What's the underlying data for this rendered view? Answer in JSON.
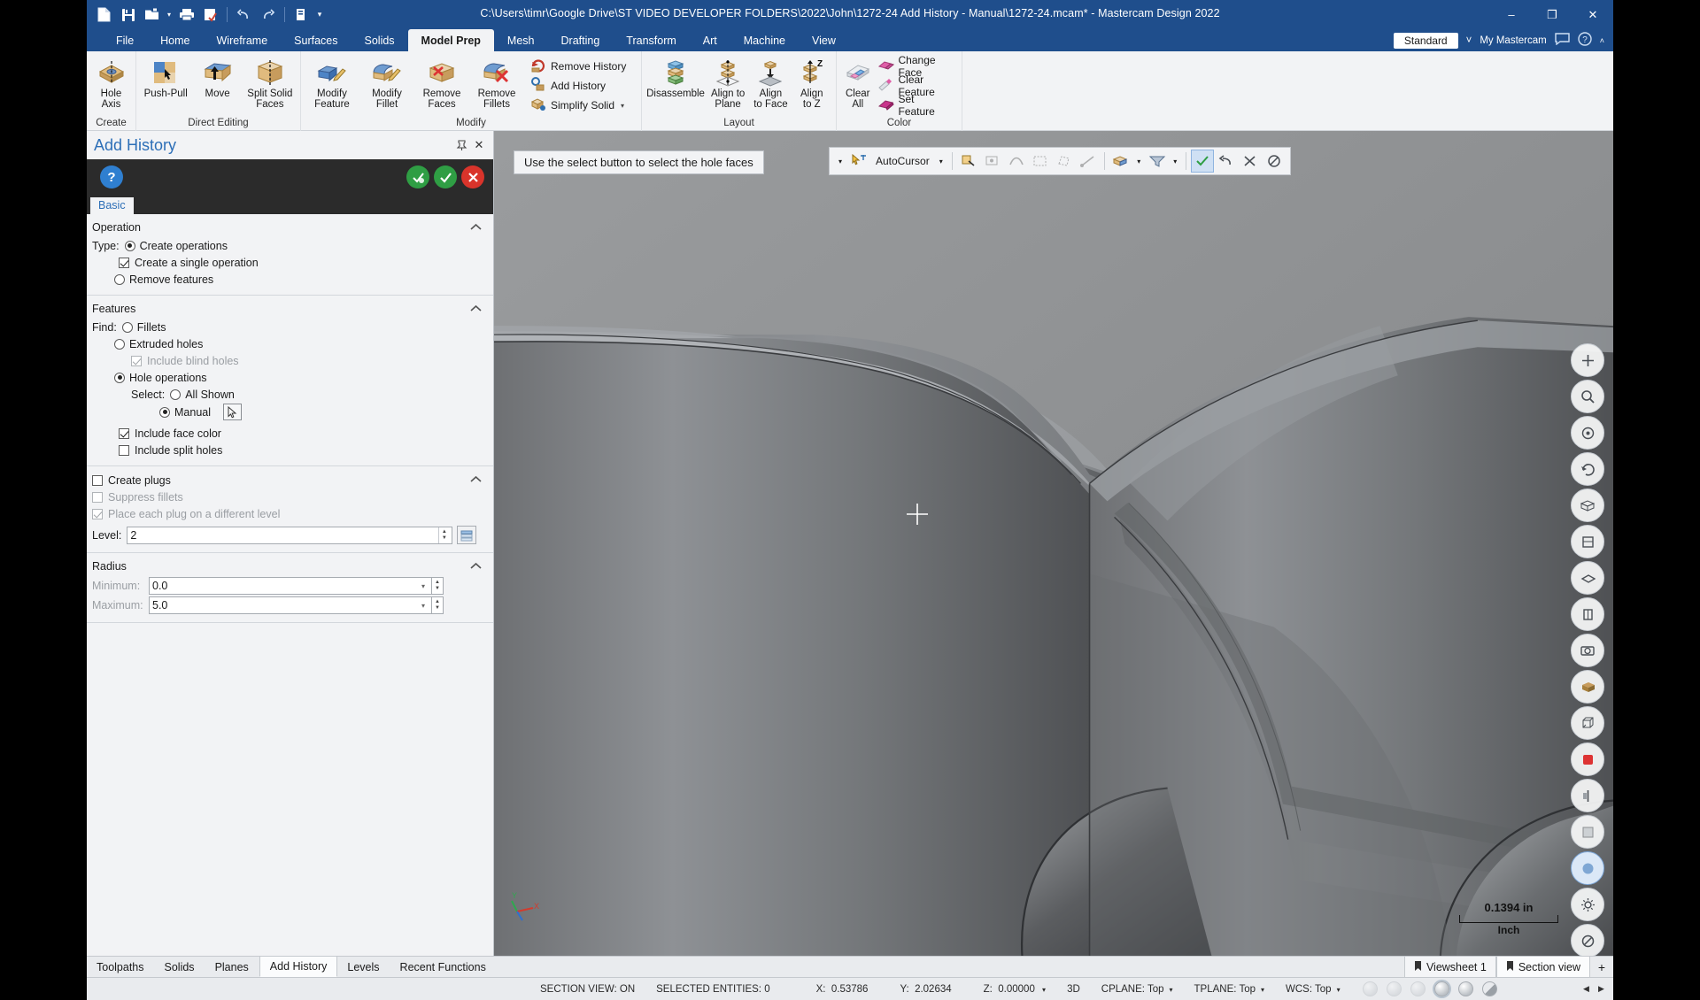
{
  "titlebar": {
    "title": "C:\\Users\\timr\\Google Drive\\ST VIDEO DEVELOPER FOLDERS\\2022\\John\\1272-24 Add History - Manual\\1272-24.mcam* - Mastercam Design 2022",
    "quick_access": [
      {
        "name": "new-icon",
        "label": "New"
      },
      {
        "name": "save-icon",
        "label": "Save"
      },
      {
        "name": "open-icon",
        "label": "Open"
      },
      {
        "name": "open-dropdown-icon",
        "label": "▾"
      },
      {
        "name": "print-icon",
        "label": "Print"
      },
      {
        "name": "print-preview-icon",
        "label": "Print Preview"
      },
      {
        "name": "undo-icon",
        "label": "Undo"
      },
      {
        "name": "redo-icon",
        "label": "Redo"
      },
      {
        "name": "customize-icon",
        "label": "Customize Quick Access Toolbar"
      },
      {
        "name": "customize-dropdown-icon",
        "label": "▾"
      }
    ],
    "window_controls": {
      "minimize": "–",
      "restore": "❐",
      "close": "✕"
    }
  },
  "ribbon": {
    "tabs": [
      {
        "label": "File",
        "active": false
      },
      {
        "label": "Home",
        "active": false
      },
      {
        "label": "Wireframe",
        "active": false
      },
      {
        "label": "Surfaces",
        "active": false
      },
      {
        "label": "Solids",
        "active": false
      },
      {
        "label": "Model Prep",
        "active": true
      },
      {
        "label": "Mesh",
        "active": false
      },
      {
        "label": "Drafting",
        "active": false
      },
      {
        "label": "Transform",
        "active": false
      },
      {
        "label": "Art",
        "active": false
      },
      {
        "label": "Machine",
        "active": false
      },
      {
        "label": "View",
        "active": false
      }
    ],
    "right": {
      "config": "Standard",
      "my_mastercam": "My Mastercam",
      "dropdown_caret": "˅"
    },
    "groups": [
      {
        "name": "Create",
        "buttons": [
          {
            "label": "Hole\nAxis",
            "line1": "Hole",
            "line2": "Axis",
            "icon": "hole-axis-icon"
          }
        ]
      },
      {
        "name": "Direct Editing",
        "buttons": [
          {
            "line1": "Push-Pull",
            "line2": "",
            "icon": "push-pull-icon"
          },
          {
            "line1": "Move",
            "line2": "",
            "icon": "move-icon"
          },
          {
            "line1": "Split Solid",
            "line2": "Faces",
            "icon": "split-solid-faces-icon"
          }
        ]
      },
      {
        "name": "Modify",
        "buttons": [
          {
            "line1": "Modify",
            "line2": "Feature",
            "icon": "modify-feature-icon"
          },
          {
            "line1": "Modify",
            "line2": "Fillet",
            "icon": "modify-fillet-icon"
          },
          {
            "line1": "Remove",
            "line2": "Faces",
            "icon": "remove-faces-icon"
          },
          {
            "line1": "Remove",
            "line2": "Fillets",
            "icon": "remove-fillets-icon"
          }
        ],
        "small_buttons": [
          {
            "label": "Remove History",
            "icon": "remove-history-icon",
            "caret": false
          },
          {
            "label": "Add History",
            "icon": "add-history-icon",
            "caret": false
          },
          {
            "label": "Simplify Solid",
            "icon": "simplify-solid-icon",
            "caret": true
          }
        ]
      },
      {
        "name": "Layout",
        "buttons": [
          {
            "line1": "Disassemble",
            "line2": "",
            "icon": "disassemble-icon"
          },
          {
            "line1": "Align to",
            "line2": "Plane",
            "icon": "align-to-plane-icon"
          },
          {
            "line1": "Align",
            "line2": "to Face",
            "icon": "align-to-face-icon"
          },
          {
            "line1": "Align",
            "line2": "to Z",
            "icon": "align-to-z-icon"
          }
        ]
      },
      {
        "name": "Color",
        "buttons": [
          {
            "line1": "Clear",
            "line2": "All",
            "icon": "clear-all-icon"
          }
        ],
        "small_buttons": [
          {
            "label": "Change Face",
            "icon": "change-face-icon",
            "caret": false
          },
          {
            "label": "Clear Feature",
            "icon": "clear-feature-icon",
            "caret": false
          },
          {
            "label": "Set Feature",
            "icon": "set-feature-icon",
            "caret": false
          }
        ]
      }
    ]
  },
  "panel": {
    "title": "Add History",
    "pin_icon": "📌",
    "close_icon": "✕",
    "toolbar": {
      "help": "?",
      "apply": "✔",
      "ok": "✔",
      "cancel": "✕"
    },
    "tab": "Basic",
    "operation": {
      "section_title": "Operation",
      "type_label": "Type:",
      "create_operations": {
        "label": "Create operations",
        "selected": true
      },
      "create_single_operation": {
        "label": "Create a single operation",
        "checked": true
      },
      "remove_features": {
        "label": "Remove features",
        "selected": false
      }
    },
    "features": {
      "section_title": "Features",
      "find_label": "Find:",
      "fillets": {
        "label": "Fillets",
        "selected": false
      },
      "extruded_holes": {
        "label": "Extruded holes",
        "selected": false
      },
      "include_blind_holes": {
        "label": "Include blind holes",
        "checked": true,
        "disabled": true
      },
      "hole_operations": {
        "label": "Hole operations",
        "selected": true
      },
      "select_label": "Select:",
      "all_shown": {
        "label": "All Shown",
        "selected": false
      },
      "manual": {
        "label": "Manual",
        "selected": true
      },
      "select_button_icon": "cursor-select-icon",
      "include_face_color": {
        "label": "Include face color",
        "checked": true
      },
      "include_split_holes": {
        "label": "Include split holes",
        "checked": false
      }
    },
    "plugs": {
      "create_plugs": {
        "label": "Create plugs",
        "checked": false
      },
      "suppress_fillets": {
        "label": "Suppress fillets",
        "checked": false,
        "disabled": true
      },
      "place_each_plug": {
        "label": "Place each plug on a different level",
        "checked": true,
        "disabled": true
      },
      "level_label": "Level:",
      "level_value": "2",
      "level_button_icon": "level-picker-icon"
    },
    "radius": {
      "section_title": "Radius",
      "minimum_label": "Minimum:",
      "minimum_value": "0.0",
      "maximum_label": "Maximum:",
      "maximum_value": "5.0"
    },
    "collapse_icon": "˄"
  },
  "viewport": {
    "hint": "Use the select button to select the hole faces",
    "selection_bar": {
      "autocursor_label": "AutoCursor",
      "autocursor_icon": "autocursor-icon",
      "dropdown_caret": "▾",
      "icons": [
        {
          "name": "select-all-icon",
          "state": "disabled"
        },
        {
          "name": "select-entity-icon",
          "state": "disabled"
        },
        {
          "name": "select-chain-icon",
          "state": "disabled"
        },
        {
          "name": "select-window-icon",
          "state": "disabled"
        },
        {
          "name": "select-polygon-icon",
          "state": "disabled"
        },
        {
          "name": "select-vector-icon",
          "state": "disabled"
        },
        {
          "name": "select-solid-face-icon",
          "state": "enabled"
        },
        {
          "name": "select-mode-dropdown-icon",
          "state": "enabled"
        },
        {
          "name": "select-filter-icon",
          "state": "enabled"
        },
        {
          "name": "select-filter-dropdown-icon",
          "state": "enabled"
        },
        {
          "name": "end-selection-icon",
          "state": "highlighted"
        },
        {
          "name": "undo-selection-icon",
          "state": "enabled"
        },
        {
          "name": "clear-selection-icon",
          "state": "enabled"
        },
        {
          "name": "unselect-icon",
          "state": "enabled"
        }
      ]
    },
    "right_toolbar": [
      {
        "name": "fit-icon"
      },
      {
        "name": "zoom-window-icon"
      },
      {
        "name": "zoom-target-icon"
      },
      {
        "name": "dynamic-rotate-icon"
      },
      {
        "name": "isometric-view-icon"
      },
      {
        "name": "front-view-icon"
      },
      {
        "name": "top-view-icon"
      },
      {
        "name": "right-view-icon"
      },
      {
        "name": "screenshot-icon"
      },
      {
        "name": "shading-icon"
      },
      {
        "name": "wireframe-icon"
      },
      {
        "name": "color-icon"
      },
      {
        "name": "section-view-icon"
      },
      {
        "name": "translucency-icon"
      },
      {
        "name": "viewsheet-icon"
      },
      {
        "name": "gear-icon"
      },
      {
        "name": "no-display-icon"
      }
    ],
    "scale": {
      "value": "0.1394 in",
      "unit": "Inch"
    },
    "axis_labels": {
      "x": "X",
      "y": "Y",
      "z": "Z"
    },
    "cursor_icon": "crosshair-cursor"
  },
  "bottom_tabs": {
    "left": [
      {
        "label": "Toolpaths",
        "active": false
      },
      {
        "label": "Solids",
        "active": false
      },
      {
        "label": "Planes",
        "active": false
      },
      {
        "label": "Add History",
        "active": true
      },
      {
        "label": "Levels",
        "active": false
      },
      {
        "label": "Recent Functions",
        "active": false
      }
    ],
    "right": [
      {
        "label": "Viewsheet 1",
        "active": false,
        "icon": "bookmark-icon"
      },
      {
        "label": "Section view",
        "active": true,
        "icon": "bookmark-icon"
      }
    ],
    "add_label": "+"
  },
  "statusbar": {
    "section_view": "SECTION VIEW: ON",
    "selected_entities": "SELECTED ENTITIES: 0",
    "x_label": "X:",
    "x_value": "0.53786",
    "y_label": "Y:",
    "y_value": "2.02634",
    "z_label": "Z:",
    "z_value": "0.00000",
    "z_caret": "▾",
    "mode": "3D",
    "cplane": "CPLANE: Top",
    "tplane": "TPLANE: Top",
    "wcs": "WCS: Top",
    "caret": "▾",
    "nav_prev": "◀",
    "nav_next": "▶"
  }
}
